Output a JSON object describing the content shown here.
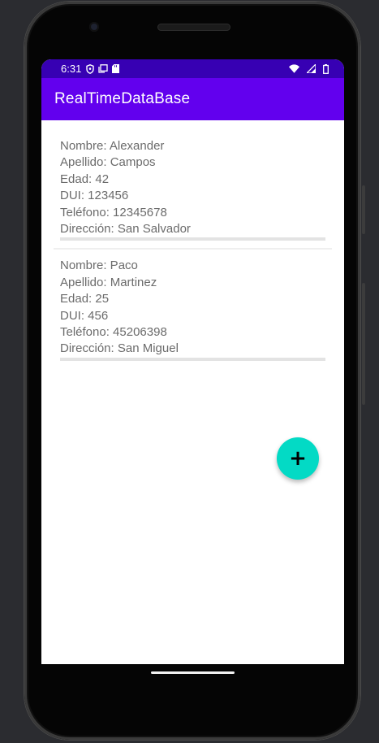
{
  "status_bar": {
    "time": "6:31",
    "icons_left": [
      "shield-icon",
      "screen-icon",
      "sd-card-icon"
    ],
    "icons_right": [
      "wifi-icon",
      "signal-icon",
      "battery-icon"
    ]
  },
  "app_bar": {
    "title": "RealTimeDataBase"
  },
  "records": [
    {
      "nombre": "Nombre: Alexander",
      "apellido": "Apellido: Campos",
      "edad": "Edad: 42",
      "dui": "DUI: 123456",
      "telefono": "Teléfono: 12345678",
      "direccion": "Dirección: San Salvador"
    },
    {
      "nombre": "Nombre: Paco",
      "apellido": "Apellido: Martinez",
      "edad": "Edad: 25",
      "dui": "DUI: 456",
      "telefono": "Teléfono: 45206398",
      "direccion": "Dirección: San Miguel"
    }
  ],
  "fab": {
    "label": "+",
    "icon": "plus-icon"
  },
  "colors": {
    "status_bar": "#3700b3",
    "app_bar": "#6200ee",
    "fab": "#03dac5",
    "record_text": "#6b6b6b"
  }
}
